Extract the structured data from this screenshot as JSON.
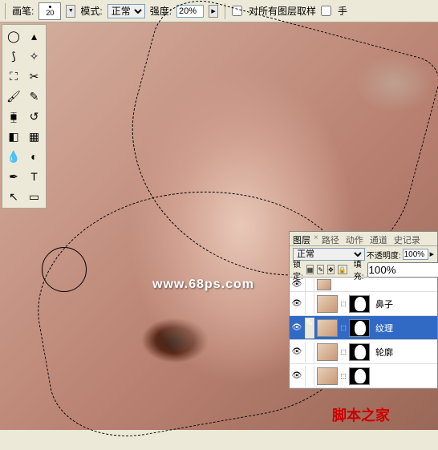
{
  "toolbar": {
    "brush_label": "画笔:",
    "brush_size": "20",
    "mode_label": "模式:",
    "mode_value": "正常",
    "strength_label": "强度:",
    "strength_value": "20%",
    "sample_all_label": "对所有图层取样",
    "finger_label": "手"
  },
  "layers_panel": {
    "tabs": [
      "图层",
      "路径",
      "动作",
      "通道",
      "史记录"
    ],
    "blend_mode": "正常",
    "opacity_label": "不透明度:",
    "opacity_value": "100%",
    "lock_label": "锁定:",
    "fill_label": "填充:",
    "fill_value": "100%",
    "layers": [
      {
        "name": "鼻子",
        "visible": true,
        "selected": false
      },
      {
        "name": "纹理",
        "visible": true,
        "selected": true
      },
      {
        "name": "轮廓",
        "visible": true,
        "selected": false
      },
      {
        "name": "",
        "visible": true,
        "selected": false
      }
    ]
  },
  "watermarks": {
    "url": "www.68ps.com",
    "site": "脚本之家"
  }
}
